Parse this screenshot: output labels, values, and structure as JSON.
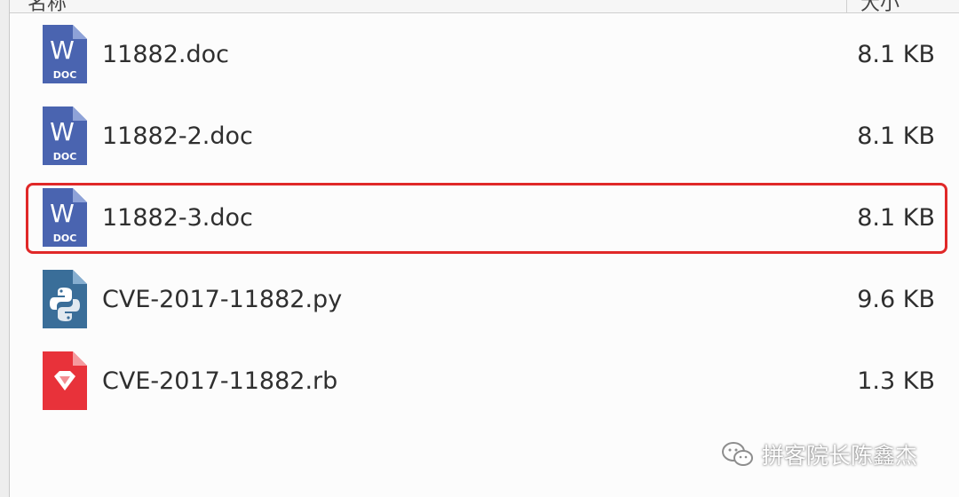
{
  "header": {
    "name_label": "名称",
    "size_label": "大小"
  },
  "files": [
    {
      "name": "11882.doc",
      "size": "8.1 KB",
      "icon": "word-doc-icon",
      "icon_color": "#4a64b0",
      "highlighted": false
    },
    {
      "name": "11882-2.doc",
      "size": "8.1 KB",
      "icon": "word-doc-icon",
      "icon_color": "#4a64b0",
      "highlighted": false
    },
    {
      "name": "11882-3.doc",
      "size": "8.1 KB",
      "icon": "word-doc-icon",
      "icon_color": "#4a64b0",
      "highlighted": true
    },
    {
      "name": "CVE-2017-11882.py",
      "size": "9.6 KB",
      "icon": "python-file-icon",
      "icon_color": "#3a6e99",
      "highlighted": false
    },
    {
      "name": "CVE-2017-11882.rb",
      "size": "1.3 KB",
      "icon": "ruby-file-icon",
      "icon_color": "#e8323a",
      "highlighted": false
    }
  ],
  "highlight_color": "#e02828",
  "doc_icon_caption": "DOC",
  "doc_icon_letter": "W",
  "watermark": {
    "text": "拼客院长陈鑫杰",
    "icon": "wechat-icon"
  }
}
